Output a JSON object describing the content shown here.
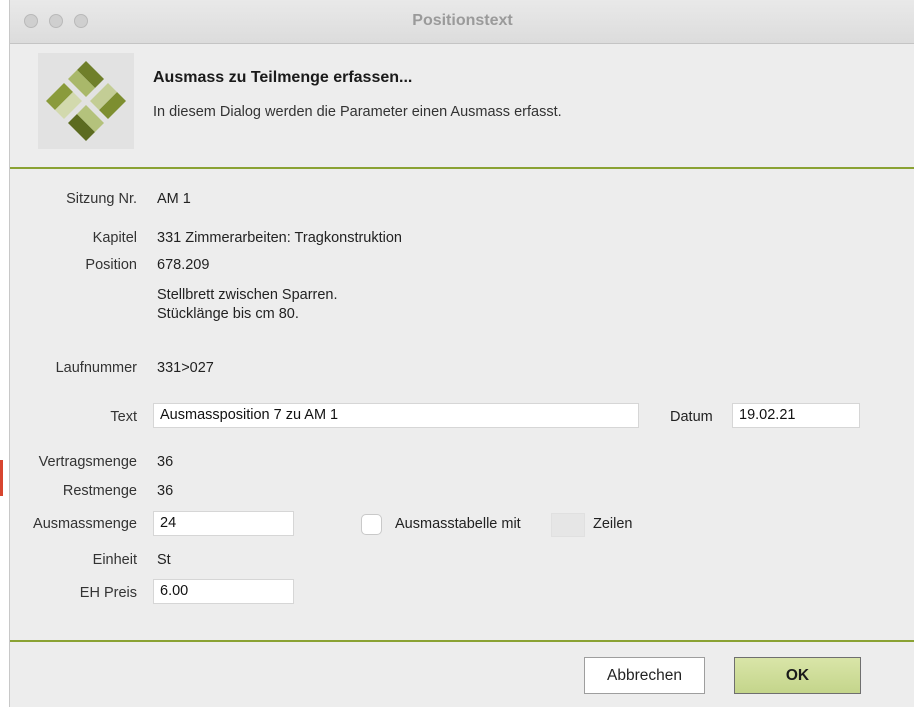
{
  "window": {
    "title": "Positionstext"
  },
  "header": {
    "title": "Ausmass zu Teilmenge erfassen...",
    "subtitle": "In diesem Dialog werden die Parameter einen Ausmass erfasst."
  },
  "form": {
    "sitzung": {
      "label": "Sitzung Nr.",
      "value": "AM 1"
    },
    "kapitel": {
      "label": "Kapitel",
      "value": "331 Zimmerarbeiten: Tragkonstruktion"
    },
    "position": {
      "label": "Position",
      "value": "678.209",
      "description_line1": "Stellbrett zwischen Sparren.",
      "description_line2": "Stücklänge bis cm 80."
    },
    "laufnummer": {
      "label": "Laufnummer",
      "value": "331>027"
    },
    "text": {
      "label": "Text",
      "value": "Ausmassposition 7 zu AM 1"
    },
    "datum": {
      "label": "Datum",
      "value": "19.02.21"
    },
    "vertragsmenge": {
      "label": "Vertragsmenge",
      "value": "36"
    },
    "restmenge": {
      "label": "Restmenge",
      "value": "36"
    },
    "ausmassmenge": {
      "label": "Ausmassmenge",
      "value": "24"
    },
    "ausmasstabelle": {
      "label_before": "Ausmasstabelle mit",
      "label_after": "Zeilen",
      "checked": false,
      "rows": ""
    },
    "einheit": {
      "label": "Einheit",
      "value": "St"
    },
    "eh_preis": {
      "label": "EH Preis",
      "value": "6.00"
    }
  },
  "buttons": {
    "cancel": "Abbrechen",
    "ok": "OK"
  },
  "colors": {
    "accent_line": "#8aa233",
    "ok_button": "#c9d98f",
    "logo": "#8a9a3a"
  },
  "icons": {
    "logo": "green-diamond-logo-icon"
  }
}
